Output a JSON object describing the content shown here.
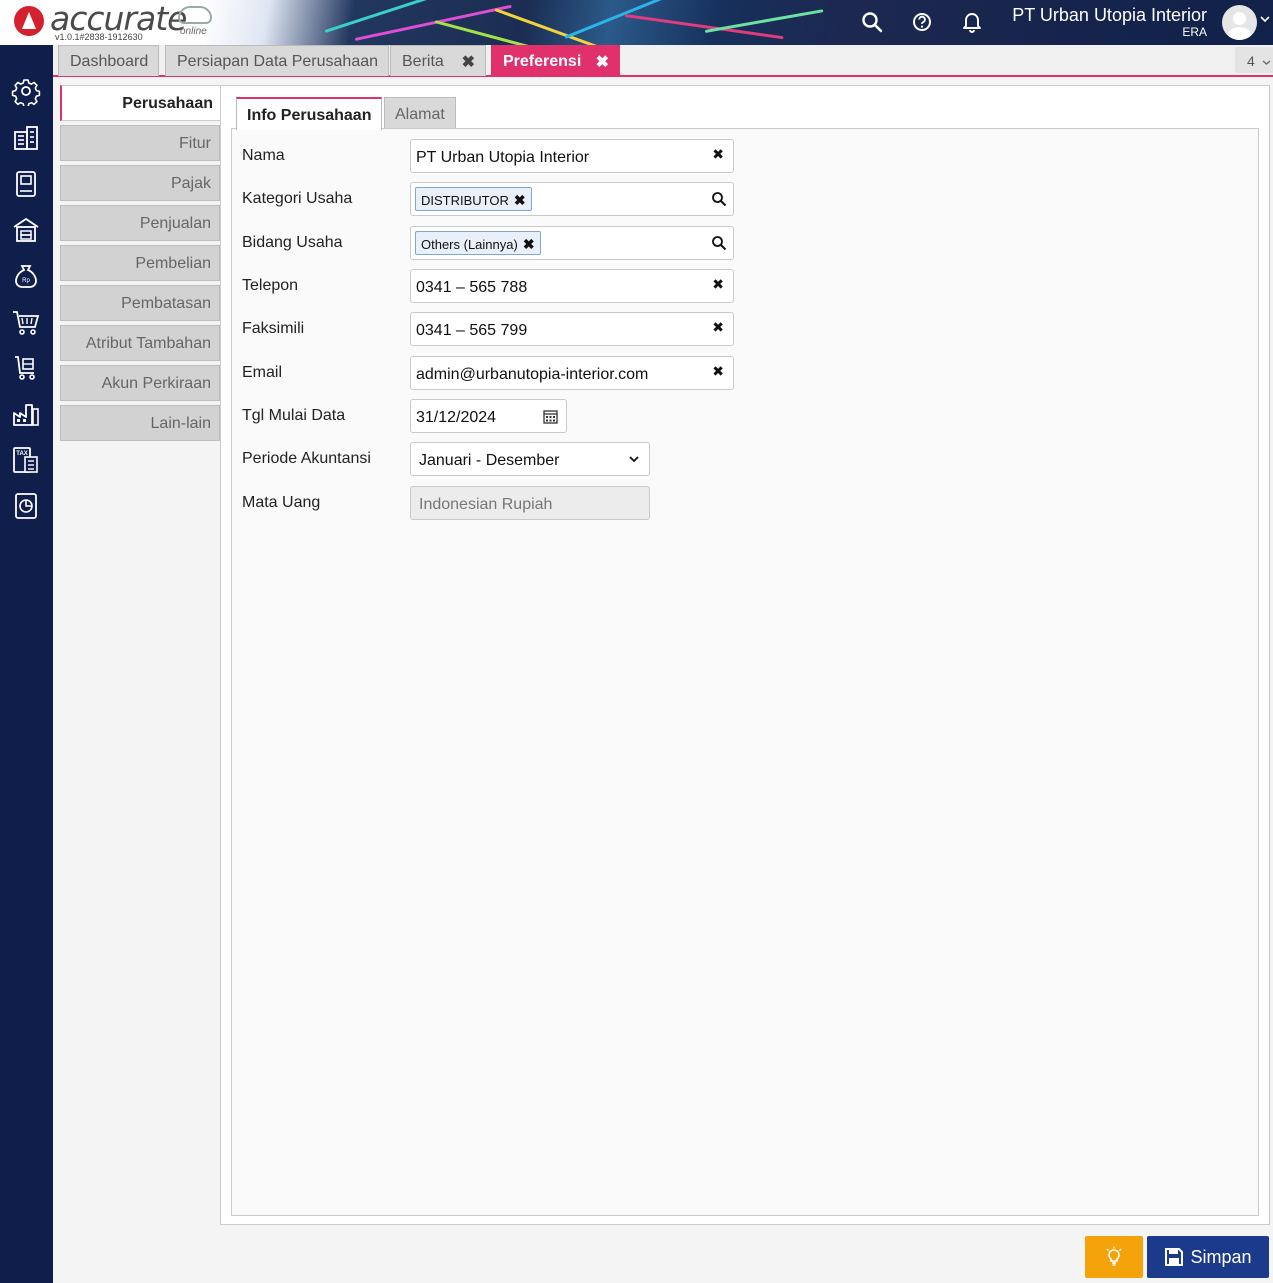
{
  "app": {
    "logo_text": "accurate",
    "logo_sub": "online",
    "version": "v1.0.1#2838-1912630",
    "company_name": "PT Urban Utopia Interior",
    "company_user": "ERA"
  },
  "header_icons": [
    "search-icon",
    "help-icon",
    "bell-icon"
  ],
  "sidebar_icons": [
    "gear-icon",
    "building-icon",
    "book-icon",
    "warehouse-icon",
    "money-bag-icon",
    "cart-icon",
    "cart-box-icon",
    "factory-icon",
    "tax-icon",
    "report-icon"
  ],
  "tabs": {
    "dashboard": "Dashboard",
    "setup": "Persiapan Data Perusahaan",
    "news": "Berita",
    "preferences": "Preferensi",
    "count": "4"
  },
  "nav": {
    "items": [
      "Perusahaan",
      "Fitur",
      "Pajak",
      "Penjualan",
      "Pembelian",
      "Pembatasan",
      "Atribut Tambahan",
      "Akun Perkiraan",
      "Lain-lain"
    ]
  },
  "inner_tabs": {
    "info": "Info Perusahaan",
    "address": "Alamat"
  },
  "form": {
    "name_label": "Nama",
    "name_value": "PT Urban Utopia Interior",
    "category_label": "Kategori Usaha",
    "category_chip": "DISTRIBUTOR",
    "field_label": "Bidang Usaha",
    "field_chip": "Others (Lainnya)",
    "phone_label": "Telepon",
    "phone_value": "0341 – 565 788",
    "fax_label": "Faksimili",
    "fax_value": "0341 – 565 799",
    "email_label": "Email",
    "email_value": "admin@urbanutopia-interior.com",
    "start_label": "Tgl Mulai Data",
    "start_value": "31/12/2024",
    "period_label": "Periode Akuntansi",
    "period_value": "Januari - Desember",
    "currency_label": "Mata Uang",
    "currency_value": "Indonesian Rupiah"
  },
  "buttons": {
    "save": "Simpan"
  },
  "colors": {
    "accent": "#e0316d",
    "sidebar": "#0f1e4a",
    "save": "#1b3a8c",
    "hint": "#f5a30a"
  }
}
